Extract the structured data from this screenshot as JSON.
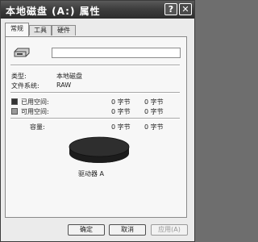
{
  "window": {
    "title": "本地磁盘 (A:) 属性",
    "help_label": "?",
    "close_label": "✕"
  },
  "tabs": [
    {
      "label": "常规"
    },
    {
      "label": "工具"
    },
    {
      "label": "硬件"
    }
  ],
  "general": {
    "drive_icon": "floppy-drive-icon",
    "name_value": "",
    "type_label": "类型:",
    "type_value": "本地磁盘",
    "fs_label": "文件系统:",
    "fs_value": "RAW",
    "used_label": "已用空间:",
    "used_bytes": "0 字节",
    "used_size": "0 字节",
    "free_label": "可用空间:",
    "free_bytes": "0 字节",
    "free_size": "0 字节",
    "capacity_label": "容量:",
    "capacity_bytes": "0 字节",
    "capacity_size": "0 字节",
    "drive_caption": "驱动器 A",
    "used_color": "#333333",
    "free_color": "#9a9a9a",
    "pie_color": "#2e2e2e"
  },
  "buttons": {
    "ok": "确定",
    "cancel": "取消",
    "apply": "应用(A)"
  }
}
